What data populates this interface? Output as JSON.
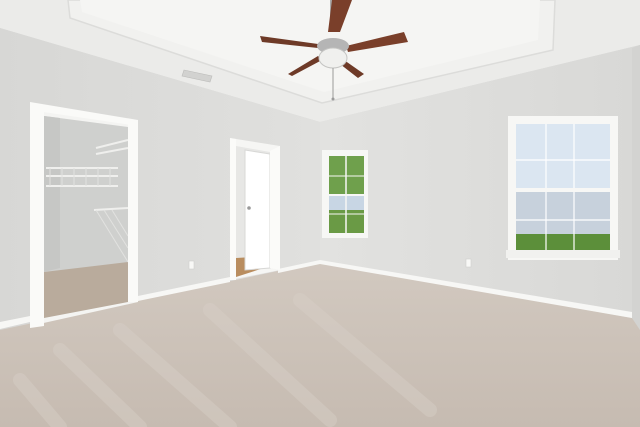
{
  "scene": {
    "description_tag": "empty-bedroom-photo",
    "colors": {
      "wall_left": "#dcdcda",
      "wall_right": "#e1e1df",
      "ceiling": "#ececea",
      "tray": "#f2f2f0",
      "carpet": "#cdc3ba",
      "trim": "#f7f7f5",
      "fan_blade": "#7a3f2a",
      "fan_metal": "#a9a9a9",
      "sky": "#d9e4ef",
      "grass": "#5c8f3a",
      "trees": "#4f8b36",
      "siding": "#cfd6de",
      "closet_wall": "#cfd0ce",
      "closet_floor": "#b6a899",
      "hall_floor": "#b58a5c"
    }
  }
}
